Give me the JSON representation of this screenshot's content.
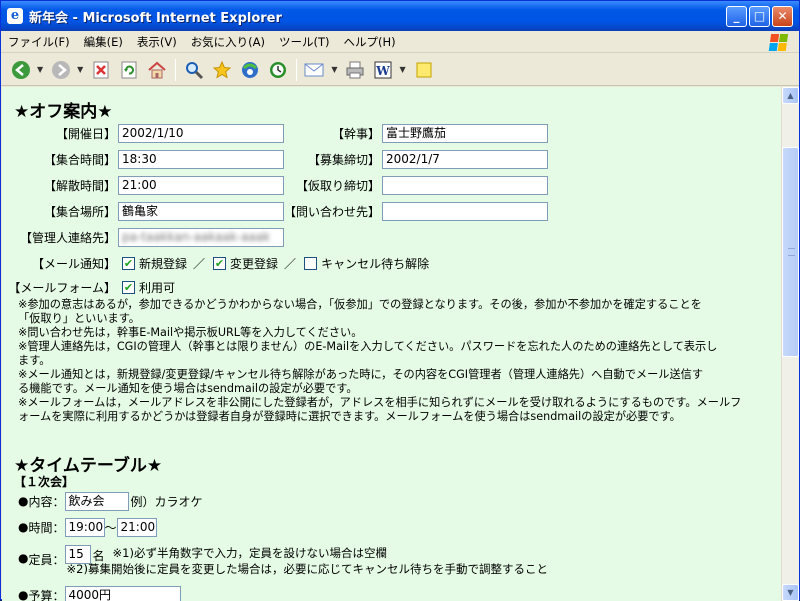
{
  "window": {
    "title": "新年会 - Microsoft Internet Explorer",
    "icon": "ie-icon"
  },
  "menu": [
    "ファイル(F)",
    "編集(E)",
    "表示(V)",
    "お気に入り(A)",
    "ツール(T)",
    "ヘルプ(H)"
  ],
  "colors": {
    "content_bg": "#e6fbe6",
    "title_blue": "#0054e3",
    "accent_green": "#21a121"
  },
  "off": {
    "heading": "★オフ案内★",
    "date_label": "【開催日】",
    "date_value": "2002/1/10",
    "kanji_label": "【幹事】",
    "kanji_value": "富士野鷹茄",
    "gather_time_label": "【集合時間】",
    "gather_time_value": "18:30",
    "deadline_label": "【募集締切】",
    "deadline_value": "2002/1/7",
    "dismiss_time_label": "【解散時間】",
    "dismiss_time_value": "21:00",
    "tentative_deadline_label": "【仮取り締切】",
    "tentative_deadline_value": "",
    "place_label": "【集合場所】",
    "place_value": "鶴亀家",
    "contact_label": "【問い合わせ先】",
    "contact_value": "",
    "admin_contact_label": "【管理人連絡先】",
    "admin_contact_value": "pa-taakkan-aakaak-aaak",
    "mail_notice_label": "【メール通知】",
    "new_reg": "新規登録",
    "sep1": "／",
    "change_reg": "変更登録",
    "sep2": "／",
    "cancel_wait": "キャンセル待ち解除",
    "mail_form_label": "【メールフォーム】",
    "mail_form_value": "利用可",
    "notes": [
      "※参加の意志はあるが，参加できるかどうかわからない場合，「仮参加」での登録となります。その後，参加か不参加かを確定することを",
      "「仮取り」といいます。",
      "※問い合わせ先は，幹事E-Mailや掲示板URL等を入力してください。",
      "※管理人連絡先は，CGIの管理人（幹事とは限りません）のE-Mailを入力してください。パスワードを忘れた人のための連絡先として表示し",
      "ます。",
      "※メール通知とは，新規登録/変更登録/キャンセル待ち解除があった時に，その内容をCGI管理者（管理人連絡先）へ自動でメール送信す",
      "る機能です。メール通知を使う場合はsendmailの設定が必要です。",
      "※メールフォームは，メールアドレスを非公開にした登録者が，アドレスを相手に知られずにメールを受け取れるようにするものです。メールフ",
      "ォームを実際に利用するかどうかは登録者自身が登録時に選択できます。メールフォームを使う場合はsendmailの設定が必要です。"
    ]
  },
  "timetable": {
    "heading": "★タイムテーブル★",
    "session": "【１次会】",
    "bullet": "●",
    "content_label": "内容：",
    "content_value": "飲み会",
    "content_example": "例）カラオケ",
    "time_label": "時間：",
    "time_start": "19:00",
    "time_tilde": "～",
    "time_end": "21:00",
    "capacity_label": "定員：",
    "capacity_value": "15",
    "capacity_unit": "名",
    "capacity_note1": "※1)必ず半角数字で入力，定員を設けない場合は空欄",
    "capacity_note2": "※2)募集開始後に定員を変更した場合は，必要に応じてキャンセル待ちを手動で調整すること",
    "budget_label": "予算：",
    "budget_value": "4000円"
  }
}
